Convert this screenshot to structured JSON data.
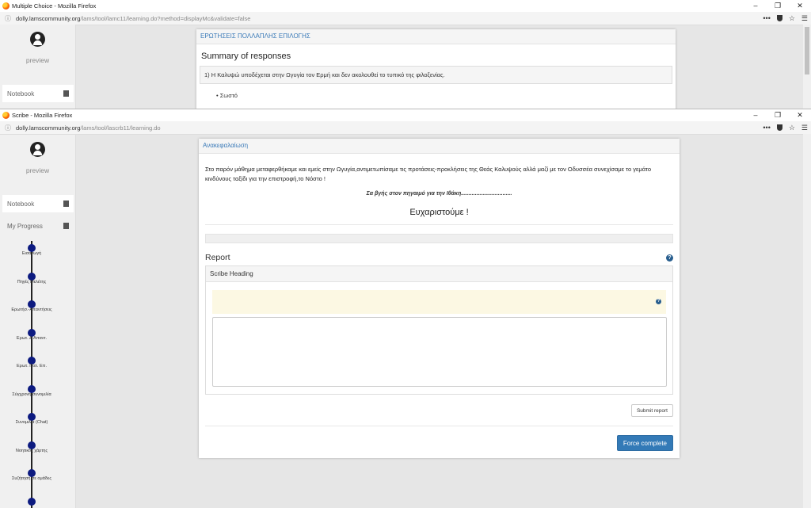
{
  "window1": {
    "title": "Multiple Choice - Mozilla Firefox",
    "url_host": "dolly.lamscommunity.org",
    "url_path": "/lams/tool/lamc11/learning.do?method=displayMc&validate=false",
    "sidebar": {
      "preview": "preview",
      "notebook": "Notebook"
    },
    "card_header": "ΕΡΩΤΗΣΕΙΣ ΠΟΛΛΑΠΛΗΣ ΕΠΙΛΟΓΗΣ",
    "summary_title": "Summary of responses",
    "question": "1) Η Καλυψώ υποδέχεται στην Ωγυγία τον Ερμή και  δεν ακολουθεί το τυπικό της φιλοξενίας.",
    "answer": "Σωστό"
  },
  "window2": {
    "title": "Scribe - Mozilla Firefox",
    "url_host": "dolly.lamscommunity.org",
    "url_path": "/lams/tool/lascrb11/learning.do",
    "sidebar": {
      "preview": "preview",
      "notebook": "Notebook",
      "my_progress": "My Progress",
      "progress_items": [
        "Εισαγωγή",
        "Πηγές Μελέτης",
        "Ερωτήσ.-Απαντήσεις",
        "Ερωτ. & Απαντ.",
        "Ερωτ. Πολ. Επ.",
        "Σύγχρονη συνομιλία",
        "Συνομιλία (Chat)",
        "Νοητικός χάρτης",
        "Συζήτηση σε ομάδες"
      ]
    },
    "card_header": "Ανακεφαλαίωση",
    "intro_text": "Στο παρόν μάθημα μεταφερθήκαμε και εμείς στην Ωγυγία,αντιμετωπίσαμε τις προτάσεις-προκλήσεις της Θεάς Καλυψούς αλλά μαζί με τον Οδυσσέα συνεχίσαμε το γεμάτο κινδύνους ταξίδι για την επιστροφή,το Νόστο !",
    "closing_text": "Σα βγής στον πηγαιμό για την Ιθάκη.................................",
    "thanks": "Ευχαριστούμε !",
    "report_title": "Report",
    "scribe_heading": "Scribe Heading",
    "submit_label": "Submit report",
    "force_label": "Force complete"
  },
  "colors": {
    "accent": "#337ab7",
    "progress_dot": "#0c1a80",
    "notice_bg": "#fcf8e3"
  },
  "icons": [
    "firefox-icon",
    "user-avatar-icon",
    "notebook-icon",
    "map-icon",
    "help-icon",
    "shield-icon",
    "star-icon",
    "menu-icon"
  ]
}
